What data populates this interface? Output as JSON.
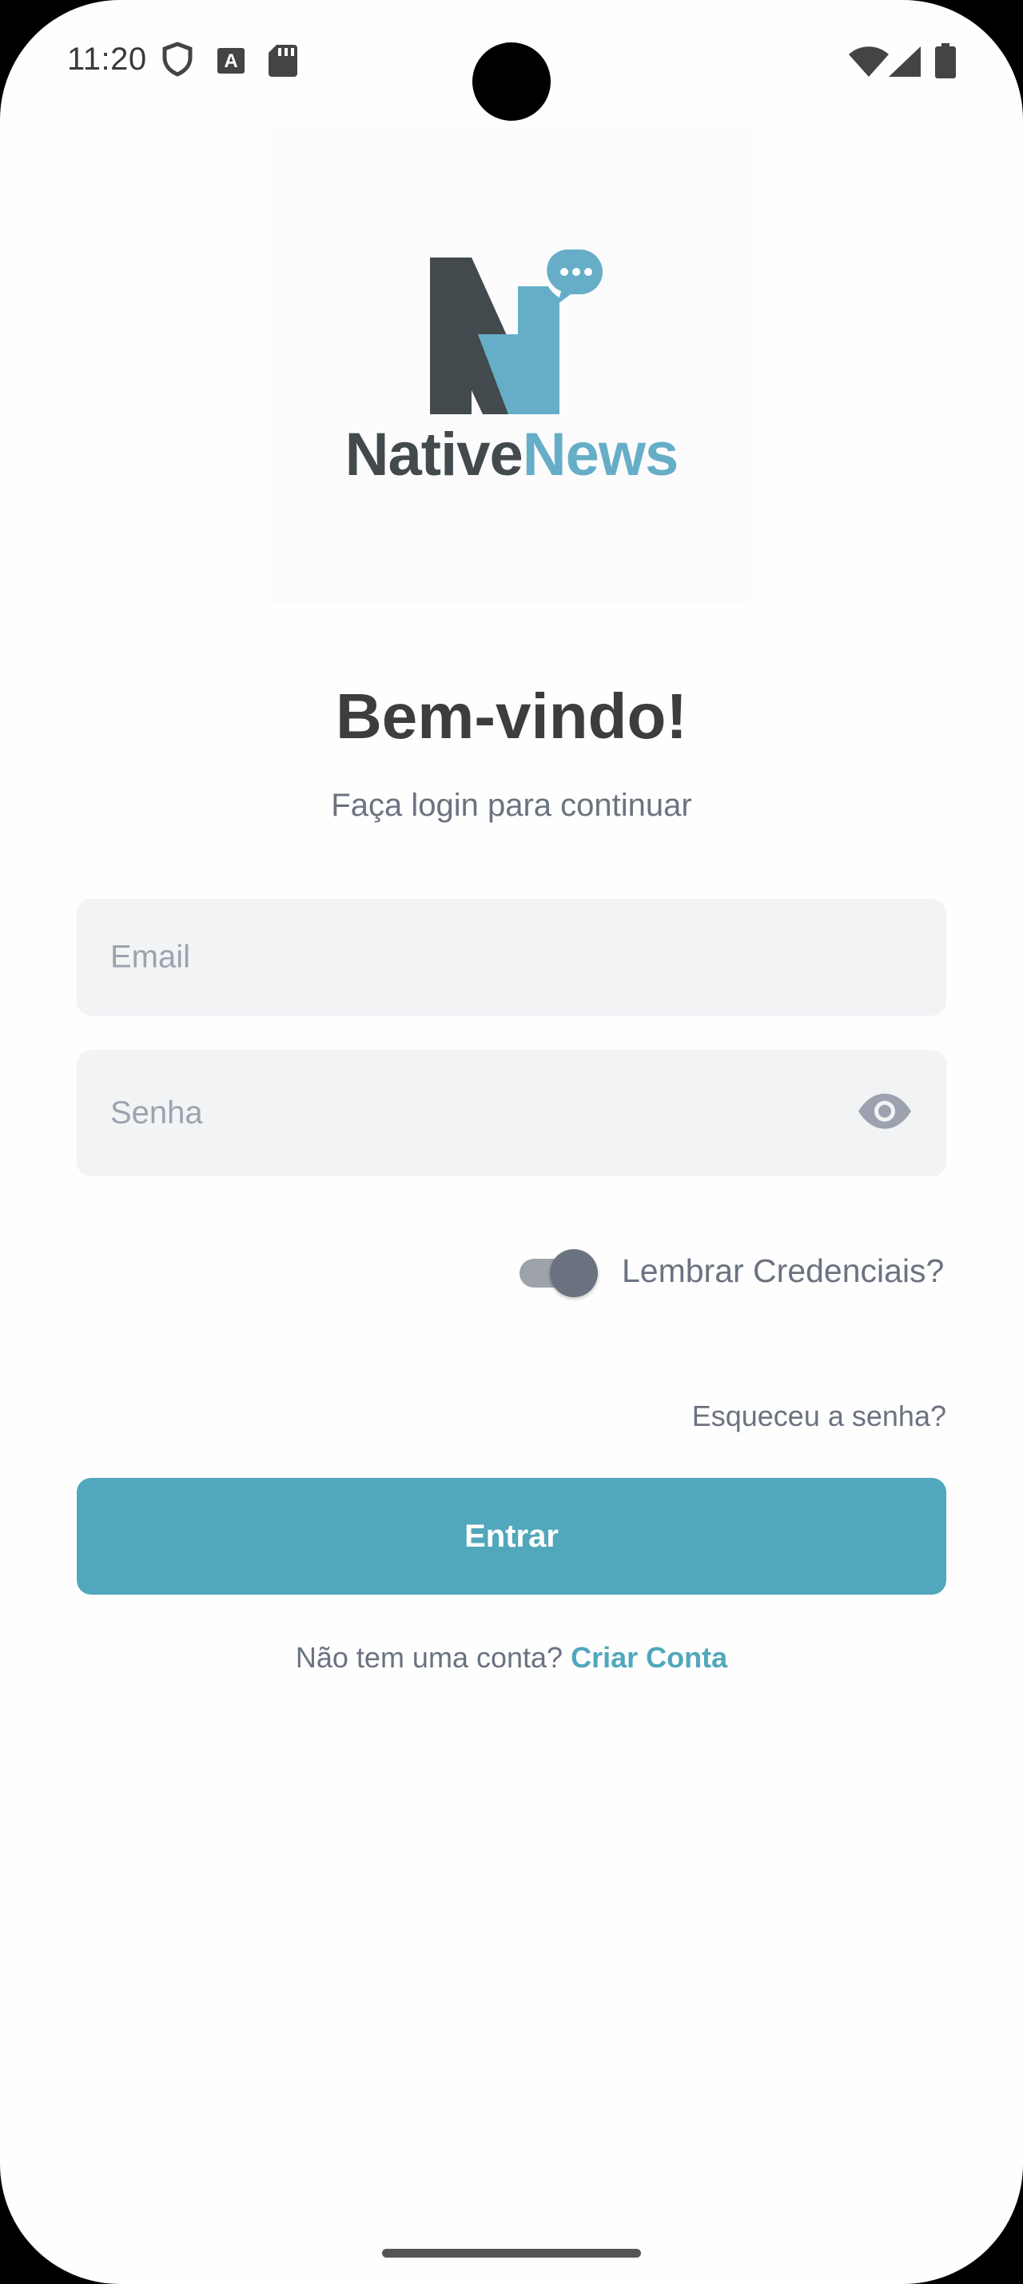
{
  "status_bar": {
    "time": "11:20",
    "left_icons": [
      "shield-icon",
      "font-a-icon",
      "sd-card-icon"
    ],
    "right_icons": [
      "wifi-icon",
      "cellular-icon",
      "battery-icon"
    ]
  },
  "logo": {
    "part1": "Native",
    "part2": "News",
    "colors": {
      "dark": "#434a4e",
      "accent": "#66aec7"
    }
  },
  "welcome": {
    "title": "Bem-vindo!",
    "subtitle": "Faça login para continuar"
  },
  "form": {
    "email_placeholder": "Email",
    "password_placeholder": "Senha",
    "remember_label": "Lembrar Credenciais?",
    "remember_on": false,
    "forgot_password": "Esqueceu a senha?",
    "submit_label": "Entrar"
  },
  "signup": {
    "prompt": "Não tem uma conta?",
    "link": "Criar Conta"
  },
  "colors": {
    "primary": "#51a7bb",
    "muted_text": "#6b7280",
    "input_bg": "#f2f3f5"
  }
}
